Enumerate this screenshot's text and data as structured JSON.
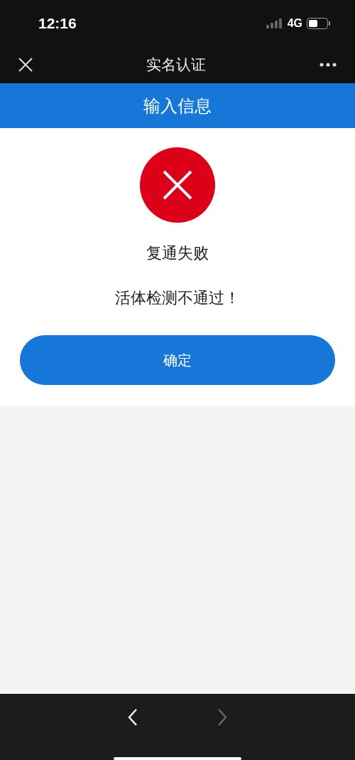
{
  "status_bar": {
    "time": "12:16",
    "network": "4G"
  },
  "nav_bar": {
    "title": "实名认证"
  },
  "header": {
    "title": "输入信息"
  },
  "result": {
    "title": "复通失败",
    "message": "活体检测不通过！"
  },
  "confirm_button": {
    "label": "确定"
  },
  "browser_toolbar": {
    "back_disabled": false,
    "forward_disabled": true
  }
}
